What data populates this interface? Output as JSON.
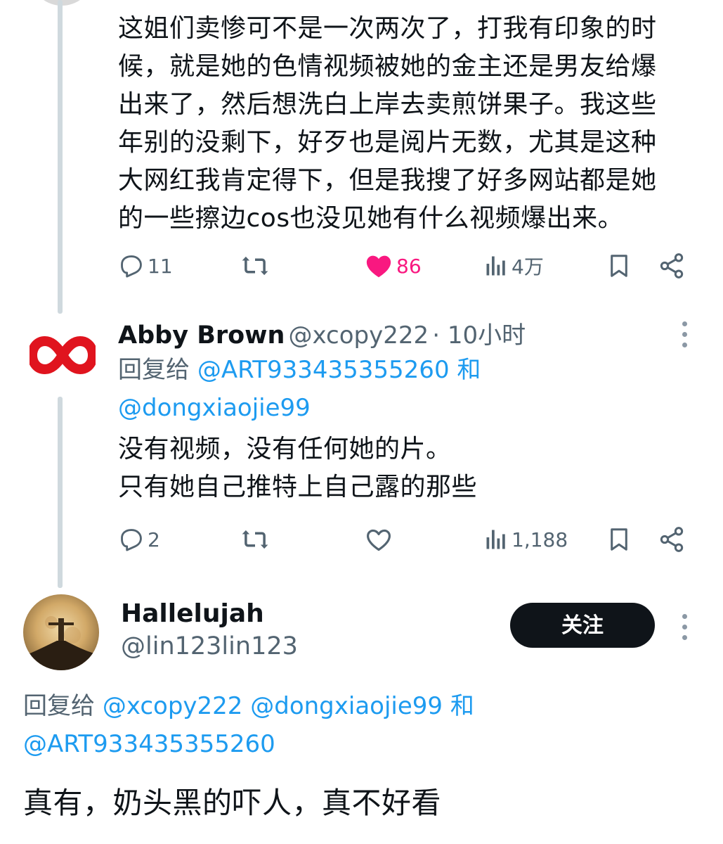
{
  "tweet1": {
    "text_lines": [
      "这姐们卖惨可不是一次两次了，打我有印象的时",
      "候，就是她的色情视频被她的金主还是男友给爆",
      "出来了，然后想洗白上岸去卖煎饼果子。我这些",
      "年别的没剩下，好歹也是阅片无数，尤其是这种",
      "大网红我肯定得下，但是我搜了好多网站都是她",
      "的一些擦边cos也没见她有什么视频爆出来。"
    ],
    "replies": "11",
    "likes": "86",
    "views": "4万",
    "liked": true
  },
  "tweet2": {
    "name": "Abby Brown",
    "handle": "@xcopy222",
    "time": "· 10小时",
    "reply_prefix": "回复给",
    "reply_mention_1": "@ART933435355260",
    "reply_and": "和",
    "reply_mention_2": "@dongxiaojie99",
    "text_lines": [
      "没有视频，没有任何她的片。",
      "只有她自己推特上自己露的那些"
    ],
    "replies": "2",
    "views": "1,188"
  },
  "tweet3": {
    "name": "Hallelujah",
    "handle": "@lin123lin123",
    "follow_label": "关注",
    "reply_prefix": "回复给",
    "reply_mention_1": "@xcopy222",
    "reply_mention_2": "@dongxiaojie99",
    "reply_and": "和",
    "reply_mention_3": "@ART933435355260",
    "text": "真有，奶头黑的吓人，真不好看"
  },
  "colors": {
    "like_pink": "#f91880",
    "link_blue": "#1d9bf0",
    "secondary": "#536471",
    "brand_red": "#e0141e"
  },
  "icons": [
    "reply-icon",
    "retweet-icon",
    "like-icon",
    "views-icon",
    "bookmark-icon",
    "share-icon",
    "more-icon",
    "infinity-logo-icon"
  ]
}
